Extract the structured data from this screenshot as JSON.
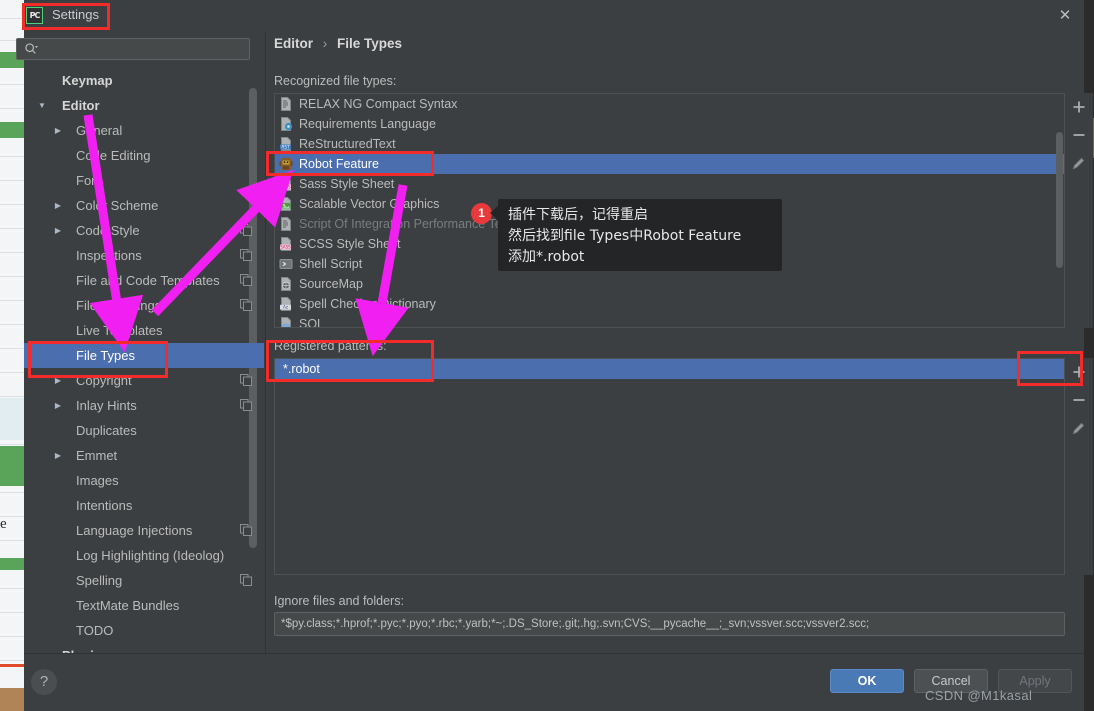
{
  "window": {
    "title": "Settings",
    "app_icon": "pycharm-icon",
    "close_icon": "close-icon"
  },
  "sidebar": {
    "search": {
      "placeholder": "",
      "value": "",
      "icon": "search-icon"
    },
    "items": [
      {
        "label": "Keymap",
        "arrow": "",
        "bold": true,
        "copy": false,
        "selected": false
      },
      {
        "label": "Editor",
        "arrow": "down",
        "bold": true,
        "copy": false,
        "selected": false
      },
      {
        "label": "General",
        "arrow": "right",
        "bold": false,
        "copy": false,
        "selected": false,
        "indent": 2
      },
      {
        "label": "Code Editing",
        "arrow": "",
        "bold": false,
        "copy": false,
        "selected": false,
        "indent": 2
      },
      {
        "label": "Font",
        "arrow": "",
        "bold": false,
        "copy": false,
        "selected": false,
        "indent": 2
      },
      {
        "label": "Color Scheme",
        "arrow": "right",
        "bold": false,
        "copy": false,
        "selected": false,
        "indent": 2
      },
      {
        "label": "Code Style",
        "arrow": "right",
        "bold": false,
        "copy": true,
        "selected": false,
        "indent": 2
      },
      {
        "label": "Inspections",
        "arrow": "",
        "bold": false,
        "copy": true,
        "selected": false,
        "indent": 2
      },
      {
        "label": "File and Code Templates",
        "arrow": "",
        "bold": false,
        "copy": true,
        "selected": false,
        "indent": 2
      },
      {
        "label": "File Encodings",
        "arrow": "",
        "bold": false,
        "copy": true,
        "selected": false,
        "indent": 2
      },
      {
        "label": "Live Templates",
        "arrow": "",
        "bold": false,
        "copy": false,
        "selected": false,
        "indent": 2
      },
      {
        "label": "File Types",
        "arrow": "",
        "bold": false,
        "copy": false,
        "selected": true,
        "indent": 2
      },
      {
        "label": "Copyright",
        "arrow": "right",
        "bold": false,
        "copy": true,
        "selected": false,
        "indent": 2
      },
      {
        "label": "Inlay Hints",
        "arrow": "right",
        "bold": false,
        "copy": true,
        "selected": false,
        "indent": 2
      },
      {
        "label": "Duplicates",
        "arrow": "",
        "bold": false,
        "copy": false,
        "selected": false,
        "indent": 2
      },
      {
        "label": "Emmet",
        "arrow": "right",
        "bold": false,
        "copy": false,
        "selected": false,
        "indent": 2
      },
      {
        "label": "Images",
        "arrow": "",
        "bold": false,
        "copy": false,
        "selected": false,
        "indent": 2
      },
      {
        "label": "Intentions",
        "arrow": "",
        "bold": false,
        "copy": false,
        "selected": false,
        "indent": 2
      },
      {
        "label": "Language Injections",
        "arrow": "",
        "bold": false,
        "copy": true,
        "selected": false,
        "indent": 2
      },
      {
        "label": "Log Highlighting (Ideolog)",
        "arrow": "",
        "bold": false,
        "copy": false,
        "selected": false,
        "indent": 2
      },
      {
        "label": "Spelling",
        "arrow": "",
        "bold": false,
        "copy": true,
        "selected": false,
        "indent": 2
      },
      {
        "label": "TextMate Bundles",
        "arrow": "",
        "bold": false,
        "copy": false,
        "selected": false,
        "indent": 2
      },
      {
        "label": "TODO",
        "arrow": "",
        "bold": false,
        "copy": false,
        "selected": false,
        "indent": 2
      },
      {
        "label": "Plugins",
        "arrow": "",
        "bold": true,
        "copy": false,
        "selected": false,
        "indent": 0
      }
    ]
  },
  "breadcrumb": {
    "parent": "Editor",
    "separator": "›",
    "current": "File Types"
  },
  "main": {
    "recognized_label": "Recognized file types:",
    "file_types": [
      {
        "label": "RELAX NG Compact Syntax",
        "icon": "file-icon",
        "selected": false,
        "disabled": false
      },
      {
        "label": "Requirements Language",
        "icon": "requirements-icon",
        "selected": false,
        "disabled": false
      },
      {
        "label": "ReStructuredText",
        "icon": "rst-icon",
        "selected": false,
        "disabled": false
      },
      {
        "label": "Robot Feature",
        "icon": "robot-icon",
        "selected": true,
        "disabled": false
      },
      {
        "label": "Sass Style Sheet",
        "icon": "sass-icon",
        "selected": false,
        "disabled": false
      },
      {
        "label": "Scalable Vector Graphics",
        "icon": "svg-icon",
        "selected": false,
        "disabled": false
      },
      {
        "label": "Script Of Integration Performance Test",
        "icon": "file-icon",
        "selected": false,
        "disabled": true
      },
      {
        "label": "SCSS Style Sheet",
        "icon": "scss-icon",
        "selected": false,
        "disabled": false
      },
      {
        "label": "Shell Script",
        "icon": "shell-icon",
        "selected": false,
        "disabled": false
      },
      {
        "label": "SourceMap",
        "icon": "sourcemap-icon",
        "selected": false,
        "disabled": false
      },
      {
        "label": "Spell Checker Dictionary",
        "icon": "dictionary-icon",
        "selected": false,
        "disabled": false
      },
      {
        "label": "SQL",
        "icon": "sql-icon",
        "selected": false,
        "disabled": false
      }
    ],
    "list_buttons": [
      {
        "name": "add-file-type-button",
        "glyph": "plus"
      },
      {
        "name": "remove-file-type-button",
        "glyph": "minus"
      },
      {
        "name": "edit-file-type-button",
        "glyph": "pencil"
      }
    ],
    "patterns_label": "Registered patterns:",
    "patterns": [
      {
        "value": "*.robot",
        "selected": true
      }
    ],
    "pattern_buttons": [
      {
        "name": "add-pattern-button",
        "glyph": "plus"
      },
      {
        "name": "remove-pattern-button",
        "glyph": "minus"
      },
      {
        "name": "edit-pattern-button",
        "glyph": "pencil"
      }
    ],
    "ignore_label": "Ignore files and folders:",
    "ignore_value": "*$py.class;*.hprof;*.pyc;*.pyo;*.rbc;*.yarb;*~;.DS_Store;.git;.hg;.svn;CVS;__pycache__;_svn;vssver.scc;vssver2.scc;"
  },
  "tooltip": {
    "badge": "1",
    "line1": "插件下载后，记得重启",
    "line2": "然后找到file Types中Robot Feature",
    "line3": "添加*.robot"
  },
  "footer": {
    "help_label": "?",
    "ok_label": "OK",
    "cancel_label": "Cancel",
    "apply_label": "Apply"
  },
  "watermark": "CSDN @M1kasal",
  "colors": {
    "dialog_bg": "#3c3f41",
    "selection_blue": "#4b6eaf",
    "annotation_red": "#f42b2b",
    "annotation_magenta": "#f21ff2",
    "badge_red": "#e8393c",
    "ok_button": "#4a7ab5"
  }
}
